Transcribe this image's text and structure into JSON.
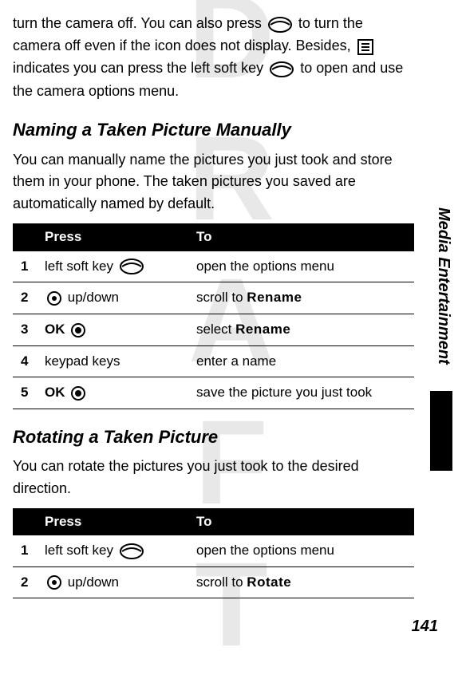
{
  "watermark": "DRAFT",
  "intro": {
    "part1": "turn the camera off. You can also press ",
    "part2": " to turn the camera off even if the icon does not display. Besides, ",
    "part3": " indicates you can press the left soft key ",
    "part4": " to open and use the camera options menu."
  },
  "section1": {
    "title": "Naming a Taken Picture Manually",
    "desc": "You can manually name the pictures you just took and store them in your phone. The taken pictures you saved are automatically named by default.",
    "table": {
      "head_press": "Press",
      "head_to": "To",
      "rows": [
        {
          "n": "1",
          "press_prefix": "left soft key ",
          "press_icon": "softkey",
          "to": "open the options menu"
        },
        {
          "n": "2",
          "press_icon": "nav",
          "press_suffix": " up/down",
          "to_prefix": "scroll to ",
          "to_bold": "Rename"
        },
        {
          "n": "3",
          "press_bold": "OK",
          "press_icon_after": "center",
          "to_prefix": "select ",
          "to_bold": "Rename"
        },
        {
          "n": "4",
          "press_text": "keypad keys",
          "to": "enter a name"
        },
        {
          "n": "5",
          "press_bold": "OK",
          "press_icon_after": "center",
          "to": "save the picture you just took"
        }
      ]
    }
  },
  "section2": {
    "title": "Rotating a Taken Picture",
    "desc": "You can rotate the pictures you just took to the desired direction.",
    "table": {
      "head_press": "Press",
      "head_to": "To",
      "rows": [
        {
          "n": "1",
          "press_prefix": "left soft key ",
          "press_icon": "softkey",
          "to": "open the options menu"
        },
        {
          "n": "2",
          "press_icon": "nav",
          "press_suffix": " up/down",
          "to_prefix": "scroll to ",
          "to_bold": "Rotate"
        }
      ]
    }
  },
  "side_tab": "Media Entertainment",
  "page_number": "141"
}
